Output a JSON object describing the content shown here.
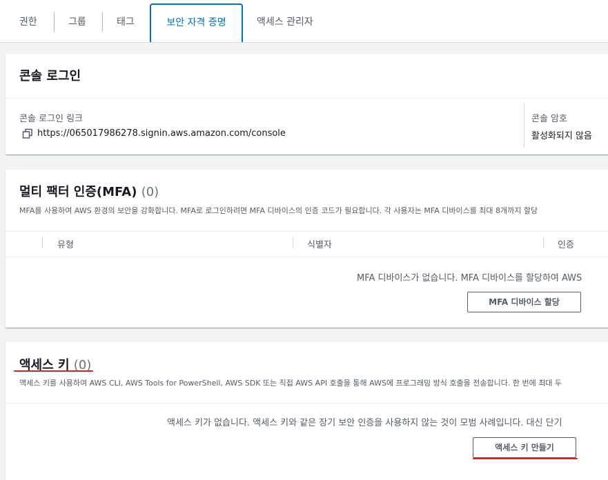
{
  "tabs": [
    {
      "label": "권한"
    },
    {
      "label": "그룹"
    },
    {
      "label": "태그"
    },
    {
      "label": "보안 자격 증명"
    },
    {
      "label": "액세스 관리자"
    }
  ],
  "console_login": {
    "title": "콘솔 로그인",
    "link_label": "콘솔 로그인 링크",
    "link_value": "https://065017986278.signin.aws.amazon.com/console",
    "password_label": "콘솔 암호",
    "password_value": "활성화되지 않음"
  },
  "mfa": {
    "title": "멀티 팩터 인증(MFA)",
    "count": "(0)",
    "description": "MFA를 사용하여 AWS 환경의 보안을 강화합니다. MFA로 로그인하려면 MFA 디바이스의 인증 코드가 필요합니다. 각 사용자는 MFA 디바이스를 최대 8개까지 할당",
    "columns": [
      "유형",
      "식별자",
      "인증"
    ],
    "empty_message": "MFA 디바이스가 없습니다. MFA 디바이스를 할당하여 AWS",
    "assign_button": "MFA 디바이스 할당"
  },
  "access_keys": {
    "title": "액세스 키",
    "count": "(0)",
    "description": "액세스 키를 사용하여 AWS CLI, AWS Tools for PowerShell, AWS SDK 또는 직접 AWS API 호출을 통해 AWS에 프로그래밍 방식 호출을 전송합니다. 한 번에 최대 두",
    "empty_message": "액세스 키가 없습니다. 액세스 키와 같은 장기 보안 인증을 사용하지 않는 것이 모범 사례입니다. 대신 단기",
    "create_button": "액세스 키 만들기"
  },
  "colors": {
    "accent": "#0073bb",
    "annotation": "#d31f26"
  }
}
